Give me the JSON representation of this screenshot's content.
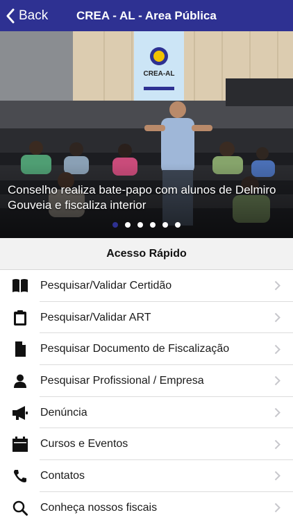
{
  "header": {
    "back_label": "Back",
    "title": "CREA - AL - Area Pública"
  },
  "carousel": {
    "caption": "Conselho realiza bate-papo com alunos de Delmiro Gouveia e fiscaliza interior",
    "banner_text": "CREA-AL",
    "slide_count": 6,
    "active_slide": 1
  },
  "quick_access": {
    "title": "Acesso Rápido",
    "items": [
      {
        "label": "Pesquisar/Validar Certidão",
        "icon": "book-icon"
      },
      {
        "label": "Pesquisar/Validar ART",
        "icon": "clipboard-icon"
      },
      {
        "label": "Pesquisar Documento de Fiscalização",
        "icon": "document-icon"
      },
      {
        "label": "Pesquisar Profissional / Empresa",
        "icon": "person-icon"
      },
      {
        "label": "Denúncia",
        "icon": "megaphone-icon"
      },
      {
        "label": "Cursos e Eventos",
        "icon": "calendar-icon"
      },
      {
        "label": "Contatos",
        "icon": "phone-icon"
      },
      {
        "label": "Conheça nossos fiscais",
        "icon": "search-icon"
      }
    ]
  },
  "colors": {
    "brand": "#2e3192",
    "list_text": "#1a1a1a",
    "chevron": "#c7c7cc"
  }
}
